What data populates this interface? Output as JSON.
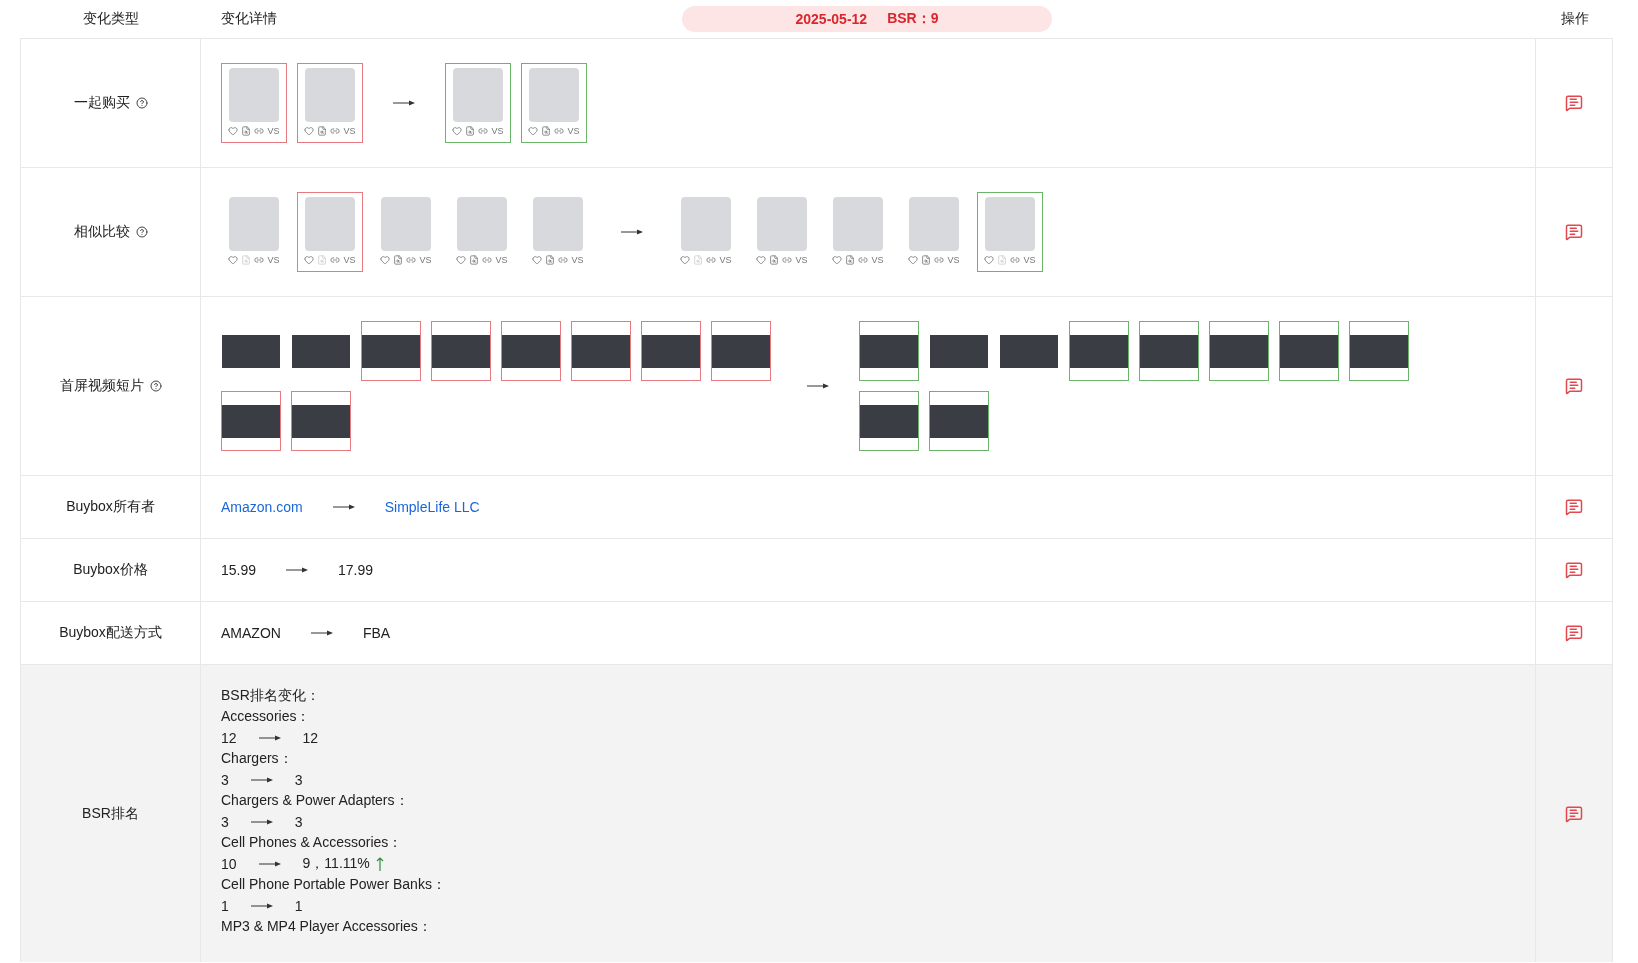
{
  "header": {
    "type_column": "变化类型",
    "detail_column": "变化详情",
    "date": "2025-05-12",
    "bsr": "BSR：9",
    "action_column": "操作"
  },
  "rows": [
    {
      "kind": "products",
      "label": "一起购买",
      "help": true,
      "highlighted": false,
      "before": [
        {
          "removed": true,
          "detail_disabled": false,
          "compare": "VS"
        },
        {
          "removed": true,
          "detail_disabled": false,
          "compare": "VS"
        }
      ],
      "after": [
        {
          "added": true,
          "detail_disabled": false,
          "compare": "VS"
        },
        {
          "added": true,
          "detail_disabled": false,
          "compare": "VS"
        }
      ]
    },
    {
      "kind": "products",
      "label": "相似比较",
      "help": true,
      "highlighted": false,
      "before": [
        {
          "removed": false,
          "detail_disabled": true,
          "compare": "VS"
        },
        {
          "removed": true,
          "detail_disabled": true,
          "compare": "VS"
        },
        {
          "removed": false,
          "detail_disabled": false,
          "compare": "VS"
        },
        {
          "removed": false,
          "detail_disabled": false,
          "compare": "VS"
        },
        {
          "removed": false,
          "detail_disabled": false,
          "compare": "VS"
        }
      ],
      "after": [
        {
          "added": false,
          "detail_disabled": true,
          "compare": "VS"
        },
        {
          "added": false,
          "detail_disabled": false,
          "compare": "VS"
        },
        {
          "added": false,
          "detail_disabled": false,
          "compare": "VS"
        },
        {
          "added": false,
          "detail_disabled": false,
          "compare": "VS"
        },
        {
          "added": true,
          "detail_disabled": true,
          "compare": "VS"
        }
      ]
    },
    {
      "kind": "videos",
      "label": "首屏视频短片",
      "help": true,
      "highlighted": false,
      "before": [
        {
          "removed": false
        },
        {
          "removed": false
        },
        {
          "removed": true
        },
        {
          "removed": true
        },
        {
          "removed": true
        },
        {
          "removed": true
        },
        {
          "removed": true
        },
        {
          "removed": true
        },
        {
          "removed": true
        },
        {
          "removed": true
        }
      ],
      "after": [
        {
          "added": true
        },
        {
          "added": false
        },
        {
          "added": false
        },
        {
          "added": true
        },
        {
          "added": true
        },
        {
          "added": true
        },
        {
          "added": true
        },
        {
          "added": true
        },
        {
          "added": true
        },
        {
          "added": true
        }
      ]
    },
    {
      "kind": "link",
      "label": "Buybox所有者",
      "help": false,
      "highlighted": false,
      "from": "Amazon.com",
      "to": "SimpleLife LLC"
    },
    {
      "kind": "text",
      "label": "Buybox价格",
      "help": false,
      "highlighted": false,
      "from": "15.99",
      "to": "17.99"
    },
    {
      "kind": "text",
      "label": "Buybox配送方式",
      "help": false,
      "highlighted": false,
      "from": "AMAZON",
      "to": "FBA"
    },
    {
      "kind": "bsr",
      "label": "BSR排名",
      "help": false,
      "highlighted": true,
      "lines": [
        {
          "kind": "category",
          "text": "BSR排名变化："
        },
        {
          "kind": "category",
          "text": "Accessories："
        },
        {
          "kind": "change",
          "from": "12",
          "to": "12"
        },
        {
          "kind": "category",
          "text": "Chargers："
        },
        {
          "kind": "change",
          "from": "3",
          "to": "3"
        },
        {
          "kind": "category",
          "text": "Chargers & Power Adapters："
        },
        {
          "kind": "change",
          "from": "3",
          "to": "3"
        },
        {
          "kind": "category",
          "text": "Cell Phones & Accessories："
        },
        {
          "kind": "change",
          "from": "10",
          "to": "9，11.11%",
          "rising": true
        },
        {
          "kind": "category",
          "text": "Cell Phone Portable Power Banks："
        },
        {
          "kind": "change",
          "from": "1",
          "to": "1"
        },
        {
          "kind": "category",
          "text": "MP3 & MP4 Player Accessories："
        }
      ]
    }
  ]
}
